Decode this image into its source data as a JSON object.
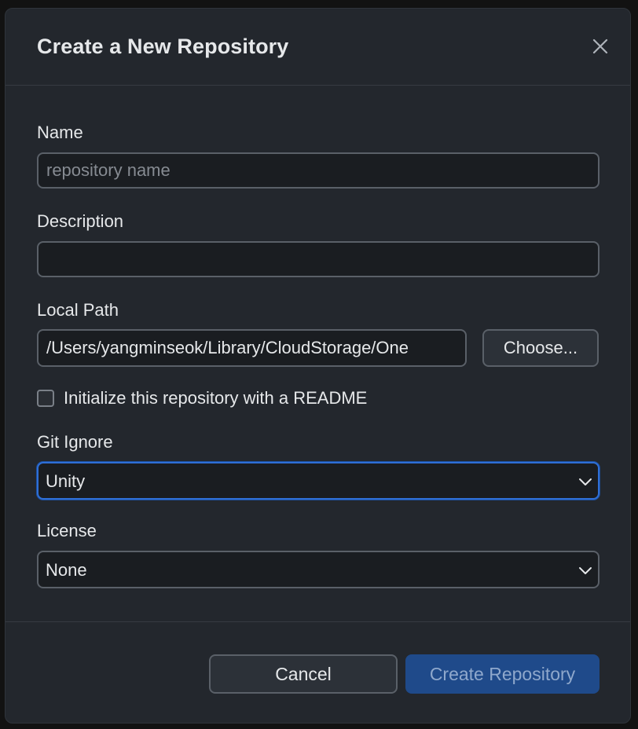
{
  "dialog": {
    "title": "Create a New Repository",
    "close_icon": "close-icon"
  },
  "form": {
    "name": {
      "label": "Name",
      "value": "",
      "placeholder": "repository name"
    },
    "description": {
      "label": "Description",
      "value": "",
      "placeholder": ""
    },
    "local_path": {
      "label": "Local Path",
      "value": "/Users/yangminseok/Library/CloudStorage/One",
      "choose_label": "Choose..."
    },
    "readme": {
      "label": "Initialize this repository with a README",
      "checked": false
    },
    "git_ignore": {
      "label": "Git Ignore",
      "selected": "Unity"
    },
    "license": {
      "label": "License",
      "selected": "None"
    }
  },
  "footer": {
    "cancel_label": "Cancel",
    "create_label": "Create Repository"
  },
  "colors": {
    "dialog_bg": "#23272d",
    "input_bg": "#1a1d21",
    "border": "#5a6068",
    "focus": "#2f6fd6",
    "primary_button": "#1f4a8a",
    "primary_button_text": "#8fa8cc"
  }
}
